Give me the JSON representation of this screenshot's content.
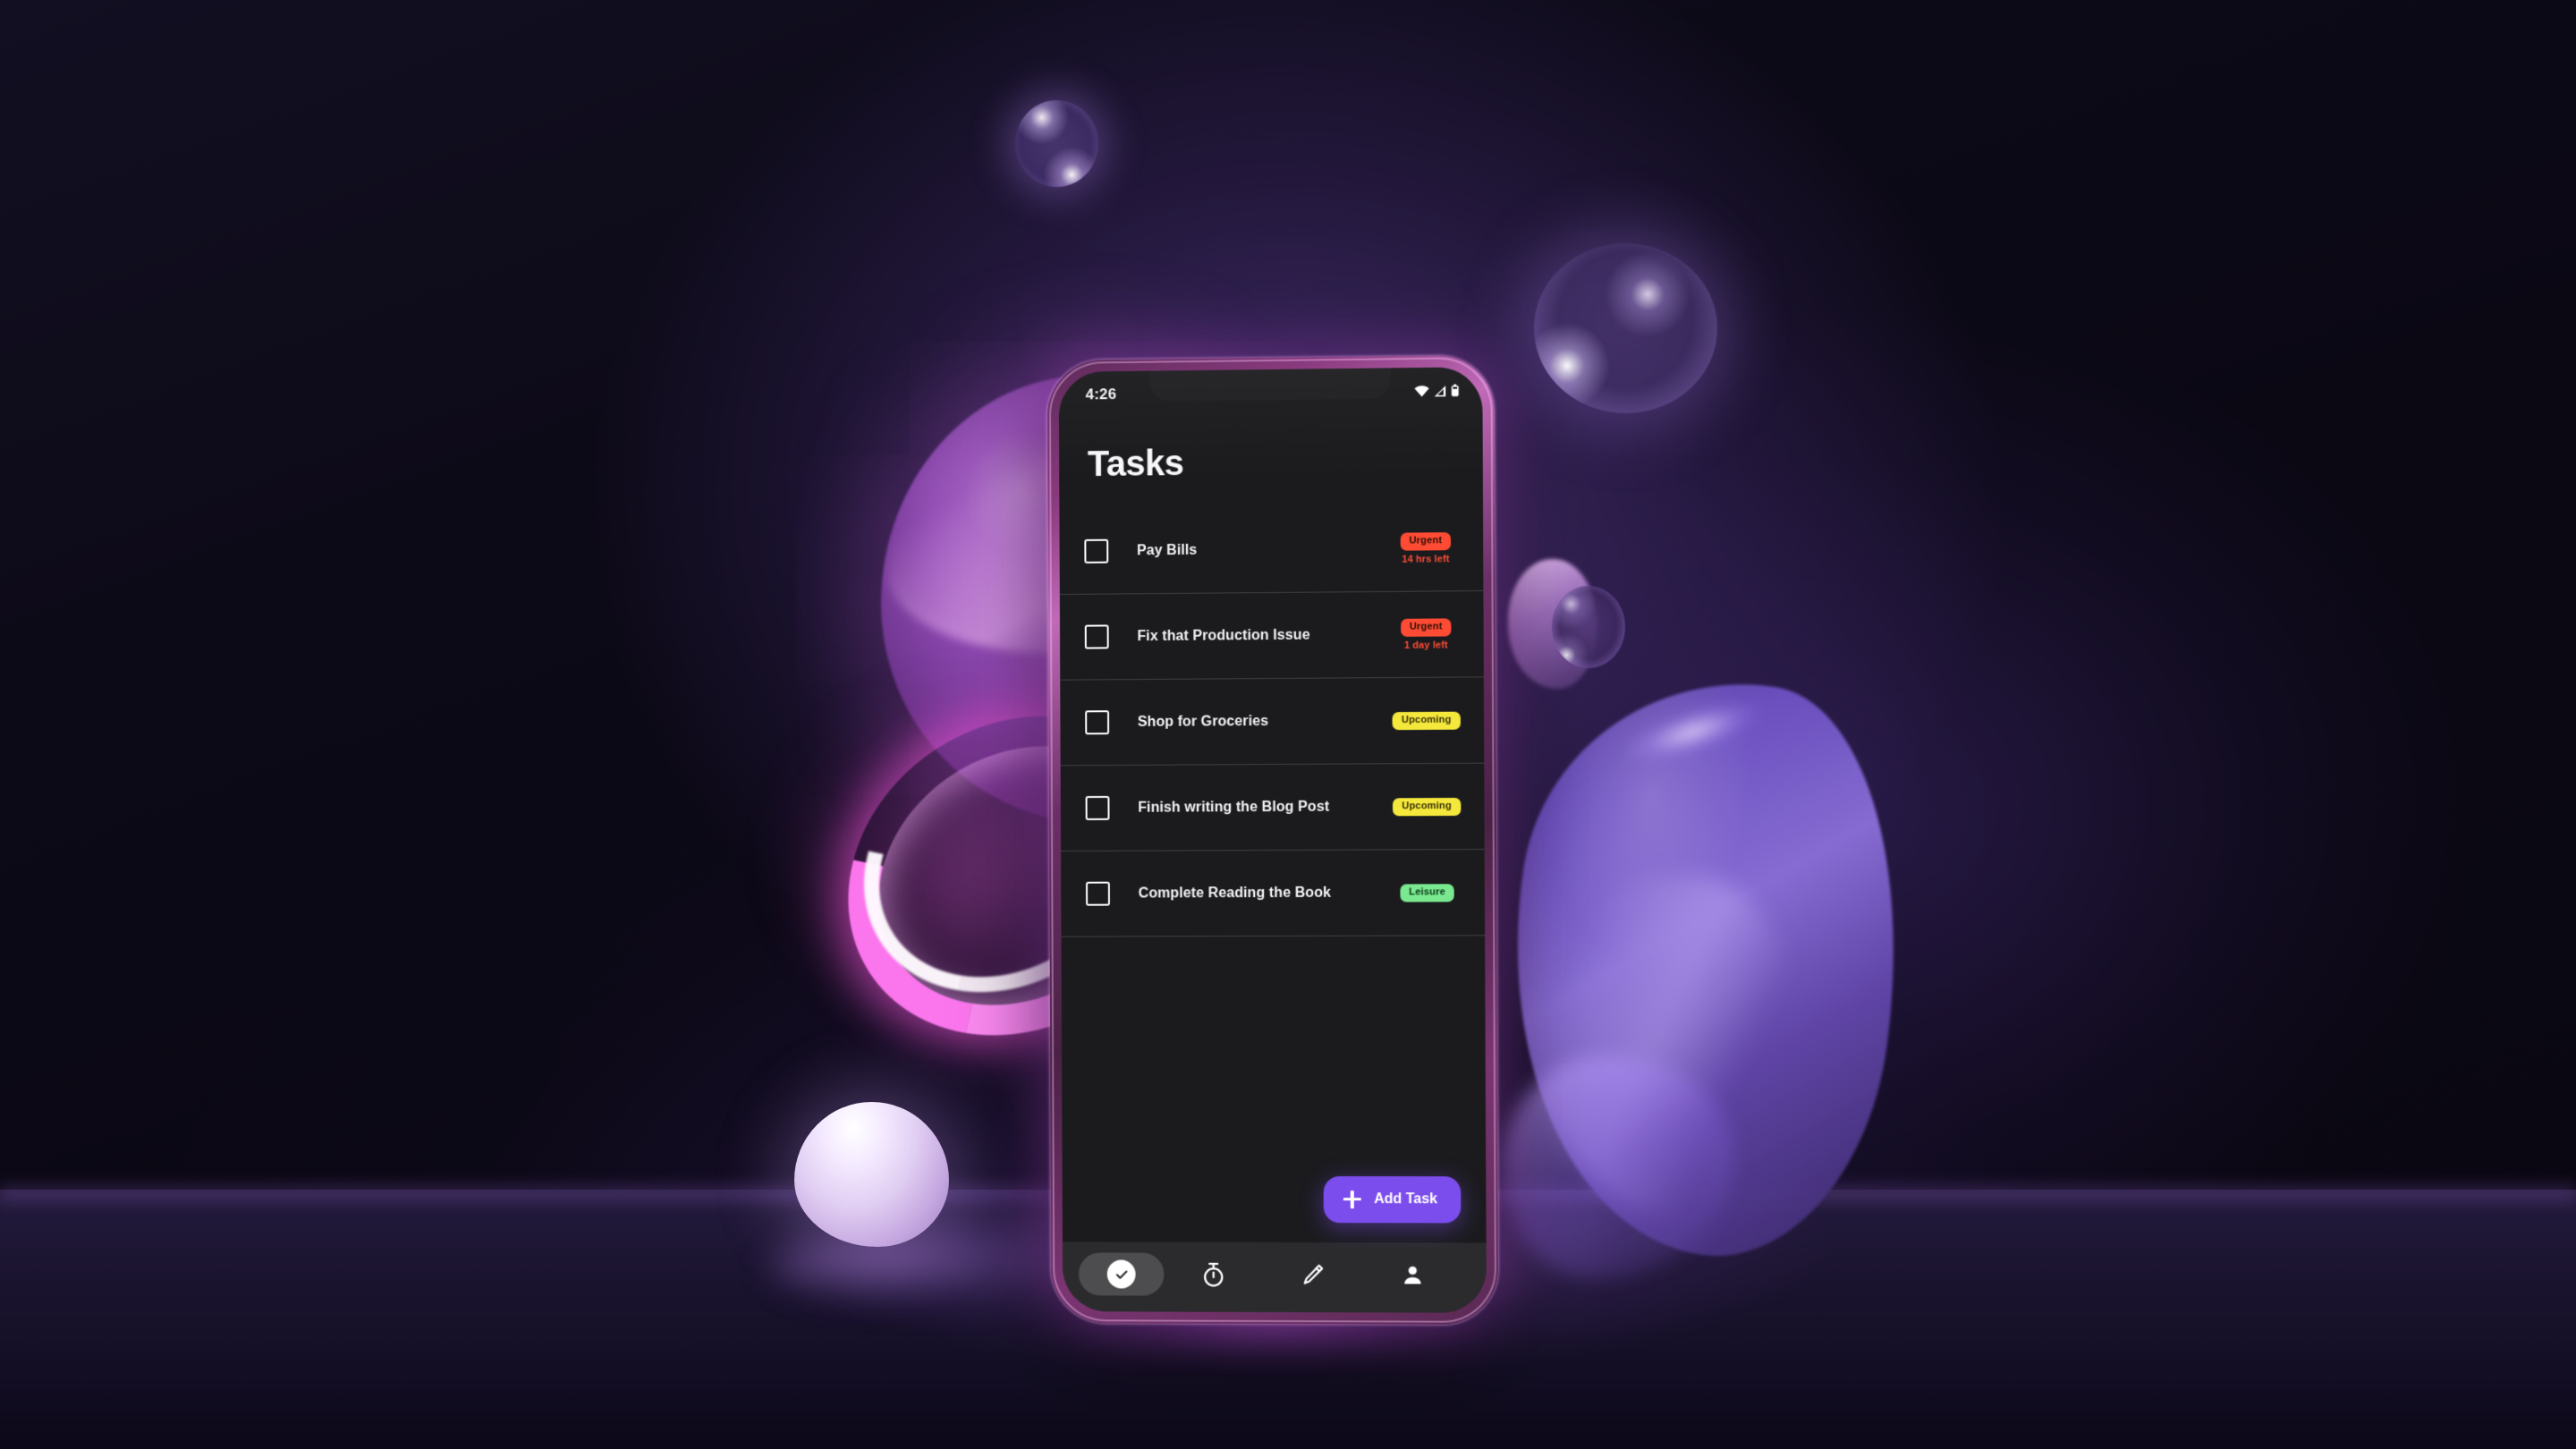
{
  "scene": {
    "description": "3d-render-dark-purple-studio-with-phone"
  },
  "phone": {
    "status_bar": {
      "time": "4:26",
      "icons": [
        "wifi-icon",
        "cellular-signal-icon",
        "battery-icon"
      ]
    },
    "page_title": "Tasks",
    "tasks": [
      {
        "label": "Pay Bills",
        "badge": "Urgent",
        "badge_type": "urgent",
        "due": "14 hrs left",
        "checked": false
      },
      {
        "label": "Fix that Production Issue",
        "badge": "Urgent",
        "badge_type": "urgent",
        "due": "1 day left",
        "checked": false
      },
      {
        "label": "Shop for Groceries",
        "badge": "Upcoming",
        "badge_type": "upcoming",
        "due": "",
        "checked": false
      },
      {
        "label": "Finish writing the Blog Post",
        "badge": "Upcoming",
        "badge_type": "upcoming",
        "due": "",
        "checked": false
      },
      {
        "label": "Complete Reading the Book",
        "badge": "Leisure",
        "badge_type": "leisure",
        "due": "",
        "checked": false
      }
    ],
    "fab": {
      "label": "Add Task",
      "icon": "plus-icon"
    },
    "bottom_nav": [
      {
        "icon": "check-circle-icon",
        "active": true
      },
      {
        "icon": "stopwatch-icon",
        "active": false
      },
      {
        "icon": "pencil-icon",
        "active": false
      },
      {
        "icon": "person-icon",
        "active": false
      }
    ]
  },
  "colors": {
    "accent_purple": "#7C4DED",
    "urgent_red": "#FF4B33",
    "upcoming_yellow": "#F5E83C",
    "leisure_green": "#79E88E",
    "screen_bg": "#1B1B1E",
    "neon_pink": "#FF78F0",
    "background_deep": "#0A0712"
  }
}
